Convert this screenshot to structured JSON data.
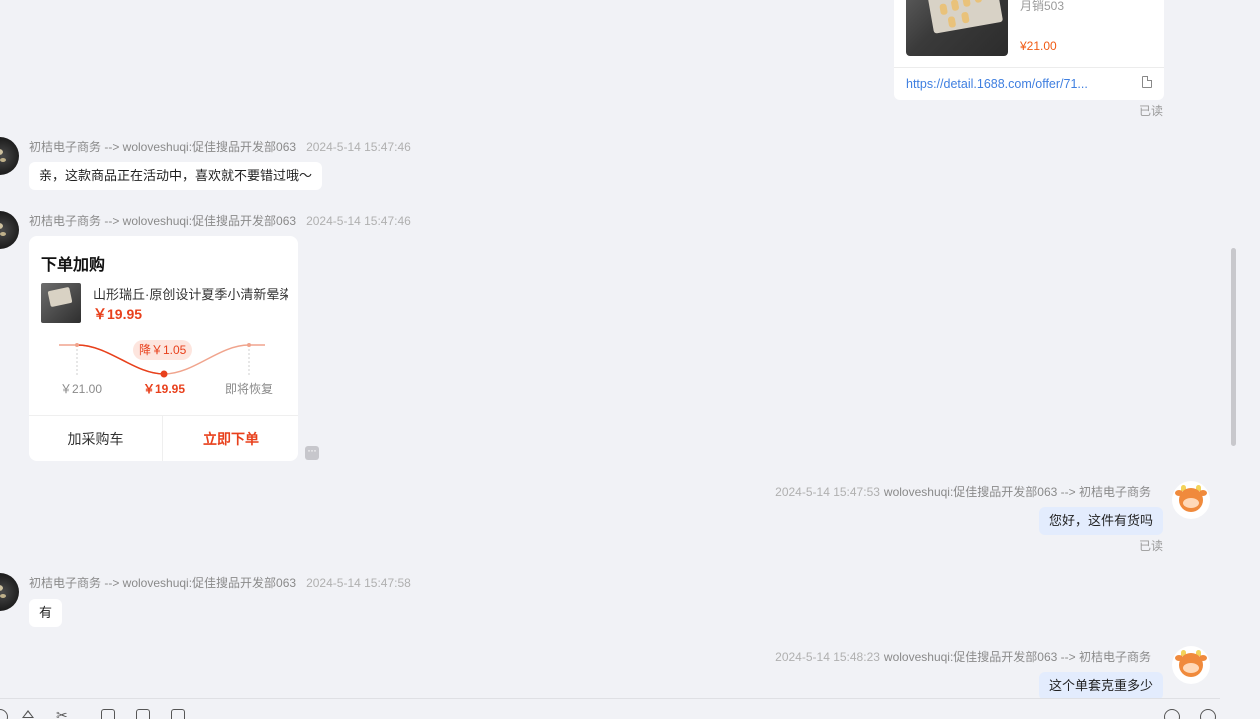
{
  "top_product": {
    "sales": "月销503",
    "price": "¥21.00",
    "link": "https://detail.1688.com/offer/71...",
    "read_status": "已读"
  },
  "messages": [
    {
      "sender_route": "初桔电子商务 --> woloveshuqi:促佳搜品开发部063",
      "time": "2024-5-14 15:47:46",
      "text": "亲，这款商品正在活动中，喜欢就不要错过哦～"
    },
    {
      "sender_route": "初桔电子商务 --> woloveshuqi:促佳搜品开发部063",
      "time": "2024-5-14 15:47:46"
    },
    {
      "sender_route": "woloveshuqi:促佳搜品开发部063 --> 初桔电子商务",
      "time": "2024-5-14 15:47:53",
      "text": "您好，这件有货吗",
      "read_status": "已读"
    },
    {
      "sender_route": "初桔电子商务 --> woloveshuqi:促佳搜品开发部063",
      "time": "2024-5-14 15:47:58",
      "text": "有"
    },
    {
      "sender_route": "woloveshuqi:促佳搜品开发部063 --> 初桔电子商务",
      "time": "2024-5-14 15:48:23",
      "text": "这个单套克重多少"
    }
  ],
  "order_card": {
    "title": "下单加购",
    "product_name": "山形瑞丘·原创设计夏季小清新晕染",
    "price": "￥19.95",
    "drop_badge": "降￥1.05",
    "label_original": "￥21.00",
    "label_current": "￥19.95",
    "label_restore": "即将恢复",
    "cart_button": "加采购车",
    "buy_button": "立即下单"
  },
  "colors": {
    "accent_orange": "#e8401c",
    "link_blue": "#3f7fe0",
    "my_bubble": "#e3ecfd",
    "background": "#f1f2f6"
  },
  "icons": [
    "copy-link-icon",
    "more-options-icon",
    "emoji-icon",
    "font-icon",
    "scissors-icon",
    "screenshot-icon",
    "folder-icon",
    "video-icon",
    "send-up-icon",
    "history-icon"
  ]
}
